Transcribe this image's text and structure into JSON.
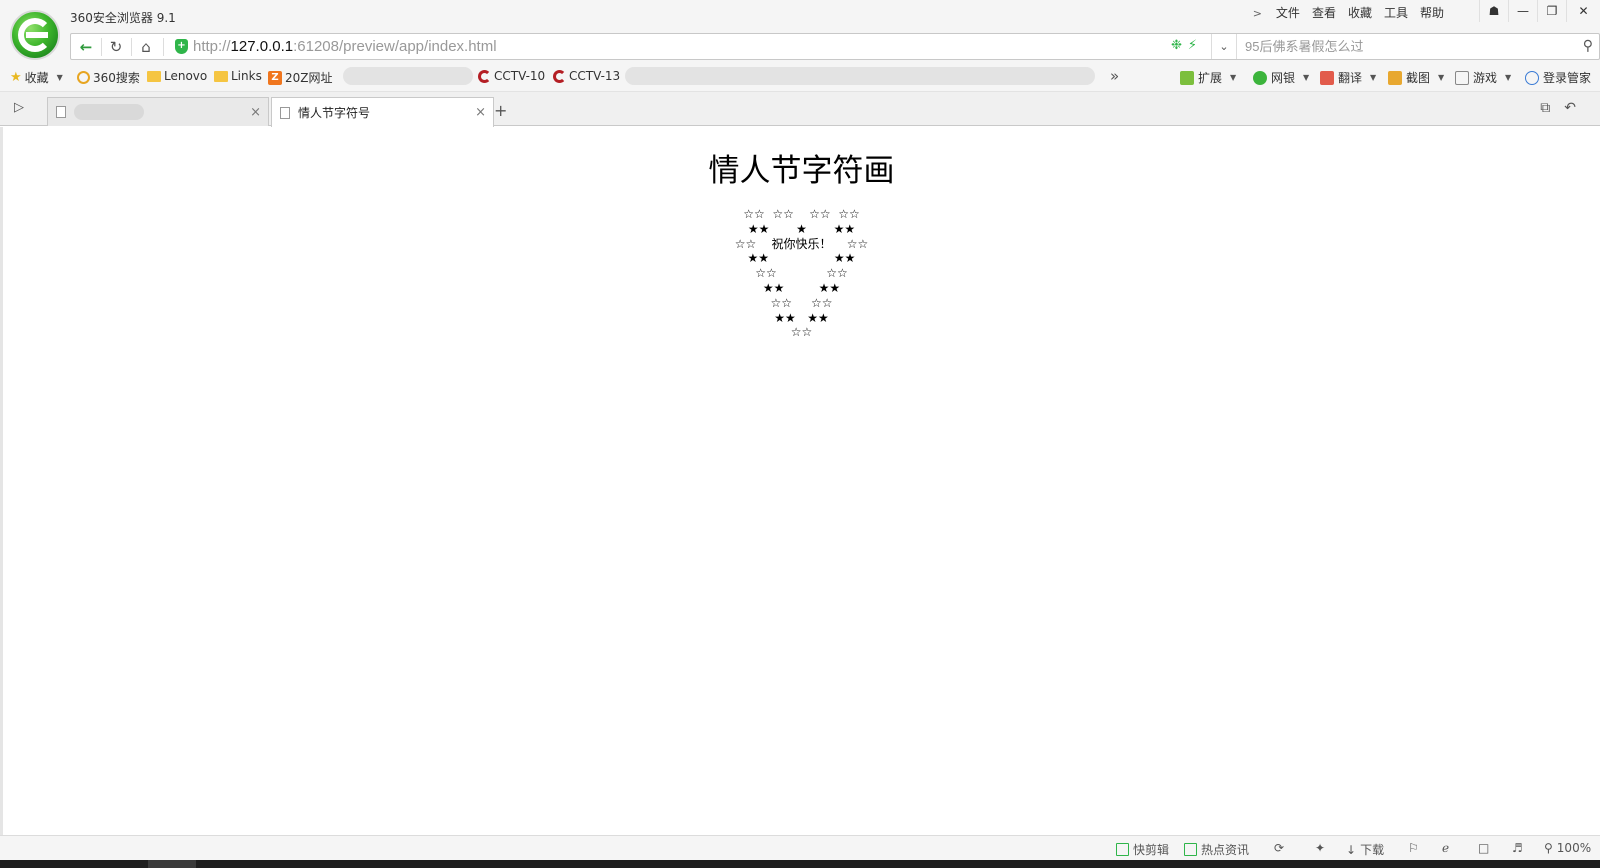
{
  "window": {
    "title": "360安全浏览器 9.1",
    "menu": [
      "文件",
      "查看",
      "收藏",
      "工具",
      "帮助"
    ],
    "controls": {
      "skin": "☗",
      "minimize": "—",
      "maximize": "❐",
      "close": "✕"
    }
  },
  "address_bar": {
    "url_scheme": "http://",
    "url_host": "127.0.0.1",
    "url_rest": ":61208/preview/app/index.html",
    "search_placeholder": "95后佛系暑假怎么过"
  },
  "bookmarks": {
    "favorites_label": "收藏",
    "items": [
      "360搜索",
      "Lenovo",
      "Links",
      "20Z网址",
      "CCTV-10",
      "CCTV-13"
    ],
    "more": "»"
  },
  "toolbar": {
    "items": [
      "扩展",
      "网银",
      "翻译",
      "截图",
      "游戏",
      "登录管家"
    ]
  },
  "tabs": [
    {
      "title": "",
      "active": false
    },
    {
      "title": "情人节字符号",
      "active": true
    }
  ],
  "page": {
    "title": "情人节字符画",
    "art_lines": [
      "☆☆  ☆☆    ☆☆  ☆☆",
      "★★       ★       ★★",
      "☆☆    祝你快乐！    ☆☆",
      "★★                 ★★",
      "☆☆             ☆☆",
      "★★         ★★",
      "☆☆     ☆☆",
      "★★   ★★",
      "☆☆"
    ]
  },
  "statusbar": {
    "items": [
      "快剪辑",
      "热点资讯",
      "下载"
    ],
    "zoom": "100%"
  },
  "colors": {
    "accent": "#2fb54a",
    "chrome_bg": "#f5f5f5"
  }
}
